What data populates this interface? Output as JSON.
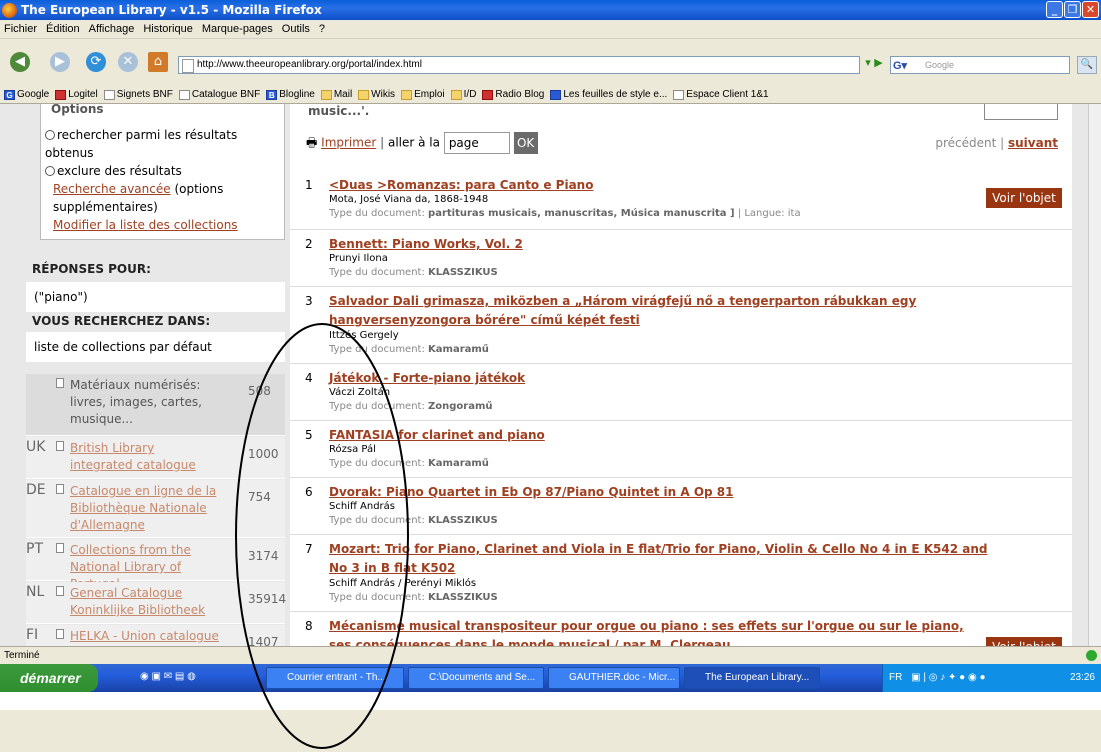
{
  "window": {
    "title": "The European Library - v1.5 - Mozilla Firefox"
  },
  "menu": [
    "Fichier",
    "Édition",
    "Affichage",
    "Historique",
    "Marque-pages",
    "Outils",
    "?"
  ],
  "nav": {
    "url": "http://www.theeuropeanlibrary.org/portal/index.html",
    "search_placeholder": "Google"
  },
  "bookmarks": [
    "Google",
    "Logitel",
    "Signets BNF",
    "Catalogue BNF",
    "Blogline",
    "Mail",
    "Wikis",
    "Emploi",
    "I/D",
    "Radio Blog",
    "Les feuilles de style e...",
    "Espace Client 1&1"
  ],
  "sidebar": {
    "options_title": "Options",
    "opt1": "rechercher parmi les résultats obtenus",
    "opt2": "exclure des résultats",
    "adv_link": "Recherche avancée",
    "adv_suffix": "(options supplémentaires)",
    "modify_link": "Modifier la liste des collections",
    "answers_heading": "RÉPONSES POUR:",
    "query": "(\"piano\")",
    "search_in_heading": "VOUS RECHERCHEZ DANS:",
    "collection_list": "liste de collections par défaut",
    "collections": [
      {
        "cc": "",
        "name": "Matériaux numérisés: livres, images, cartes, musique...",
        "count": "508"
      },
      {
        "cc": "UK",
        "name": "British Library integrated catalogue",
        "count": "1000"
      },
      {
        "cc": "DE",
        "name": "Catalogue en ligne de la Bibliothèque Nationale d'Allemagne",
        "count": "754"
      },
      {
        "cc": "PT",
        "name": "Collections from the National Library of Portugal",
        "count": "3174"
      },
      {
        "cc": "NL",
        "name": "General Catalogue Koninklijke Bibliotheek",
        "count": "35914"
      },
      {
        "cc": "FI",
        "name": "HELKA - Union catalogue of",
        "count": "1407"
      }
    ]
  },
  "main": {
    "top_snippet": "music...'.",
    "print": "Imprimer",
    "goto": "aller à la",
    "page_value": "page",
    "ok": "OK",
    "prev": "précédent",
    "next": "suivant",
    "voir": "Voir l'objet",
    "results": [
      {
        "num": "1",
        "title": "<Duas >Romanzas: para Canto e Piano",
        "author": "Mota, José Viana da, 1868-1948",
        "type_label": "Type du document:",
        "type": "partituras musicais, manuscritas, Música manuscrita ]",
        "lang": "| Langue: ita"
      },
      {
        "num": "2",
        "title": "Bennett: Piano Works, Vol. 2",
        "author": "Prunyi Ilona",
        "type_label": "Type du document:",
        "type": "KLASSZIKUS",
        "lang": ""
      },
      {
        "num": "3",
        "title": "Salvador Dali grimasza, miközben a „Három virágfejű nő a tengerparton rábukkan egy hangversenyzongora bőrére\" című képét festi",
        "author": "Ittzés Gergely",
        "type_label": "Type du document:",
        "type": "Kamaramű",
        "lang": ""
      },
      {
        "num": "4",
        "title": "Játékok - Forte-piano játékok",
        "author": "Váczi Zoltán",
        "type_label": "Type du document:",
        "type": "Zongoramű",
        "lang": ""
      },
      {
        "num": "5",
        "title": "FANTASIA for clarinet and piano",
        "author": "Rózsa Pál",
        "type_label": "Type du document:",
        "type": "Kamaramű",
        "lang": ""
      },
      {
        "num": "6",
        "title": "Dvorak: Piano Quartet in Eb Op 87/Piano Quintet in A Op 81",
        "author": "Schiff András",
        "type_label": "Type du document:",
        "type": "KLASSZIKUS",
        "lang": ""
      },
      {
        "num": "7",
        "title": "Mozart: Trio for Piano, Clarinet and Viola in E flat/Trio for Piano, Violin & Cello No 4 in E K542 and No 3 in B flat K502",
        "author": "Schiff András / Perényi Miklós",
        "type_label": "Type du document:",
        "type": "KLASSZIKUS",
        "lang": ""
      },
      {
        "num": "8",
        "title": "Mécanisme musical transpositeur pour orgue ou piano : ses effets sur l'orgue ou sur le piano, ses conséquences dans le monde musical / par M. Clergeau,...",
        "author": "",
        "type_label": "",
        "type": "",
        "lang": ""
      }
    ]
  },
  "status": "Terminé",
  "taskbar": {
    "start": "démarrer",
    "items": [
      "Courrier entrant - Th...",
      "C:\\Documents and Se...",
      "GAUTHIER.doc - Micr...",
      "The European Library..."
    ],
    "lang": "FR",
    "clock": "23:26"
  }
}
